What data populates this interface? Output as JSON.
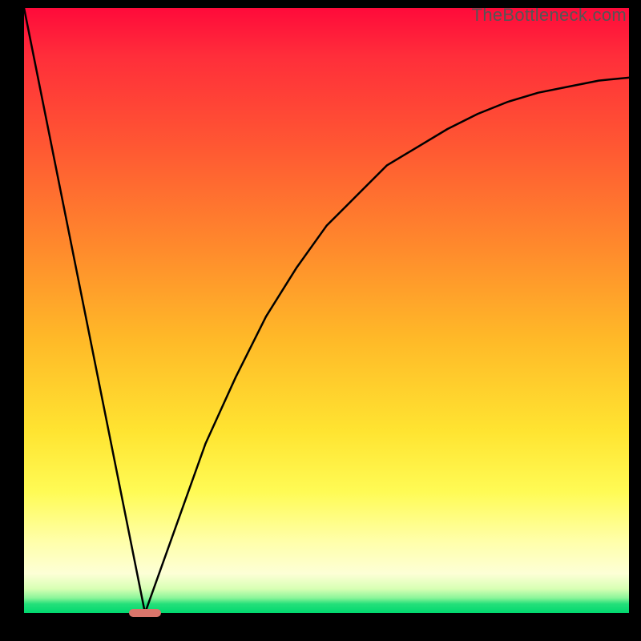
{
  "watermark": "TheBottleneck.com",
  "chart_data": {
    "type": "line",
    "title": "",
    "xlabel": "",
    "ylabel": "",
    "xlim": [
      0,
      100
    ],
    "ylim": [
      0,
      100
    ],
    "grid": false,
    "legend": false,
    "background": {
      "gradient_top": "#ff0a3a",
      "gradient_bottom": "#00d86f",
      "meaning": "bottleneck severity (red high, green low)"
    },
    "series": [
      {
        "name": "left-line",
        "x": [
          0,
          20
        ],
        "y": [
          100,
          0
        ]
      },
      {
        "name": "right-curve",
        "x": [
          20,
          25,
          30,
          35,
          40,
          45,
          50,
          55,
          60,
          65,
          70,
          75,
          80,
          85,
          90,
          95,
          100
        ],
        "y": [
          0,
          14,
          28,
          39,
          49,
          57,
          64,
          69,
          74,
          77,
          80,
          82.5,
          84.5,
          86,
          87,
          88,
          88.5
        ]
      }
    ],
    "marker": {
      "x_center": 20,
      "y": 0,
      "x_width": 5,
      "color": "#d9756b"
    }
  }
}
